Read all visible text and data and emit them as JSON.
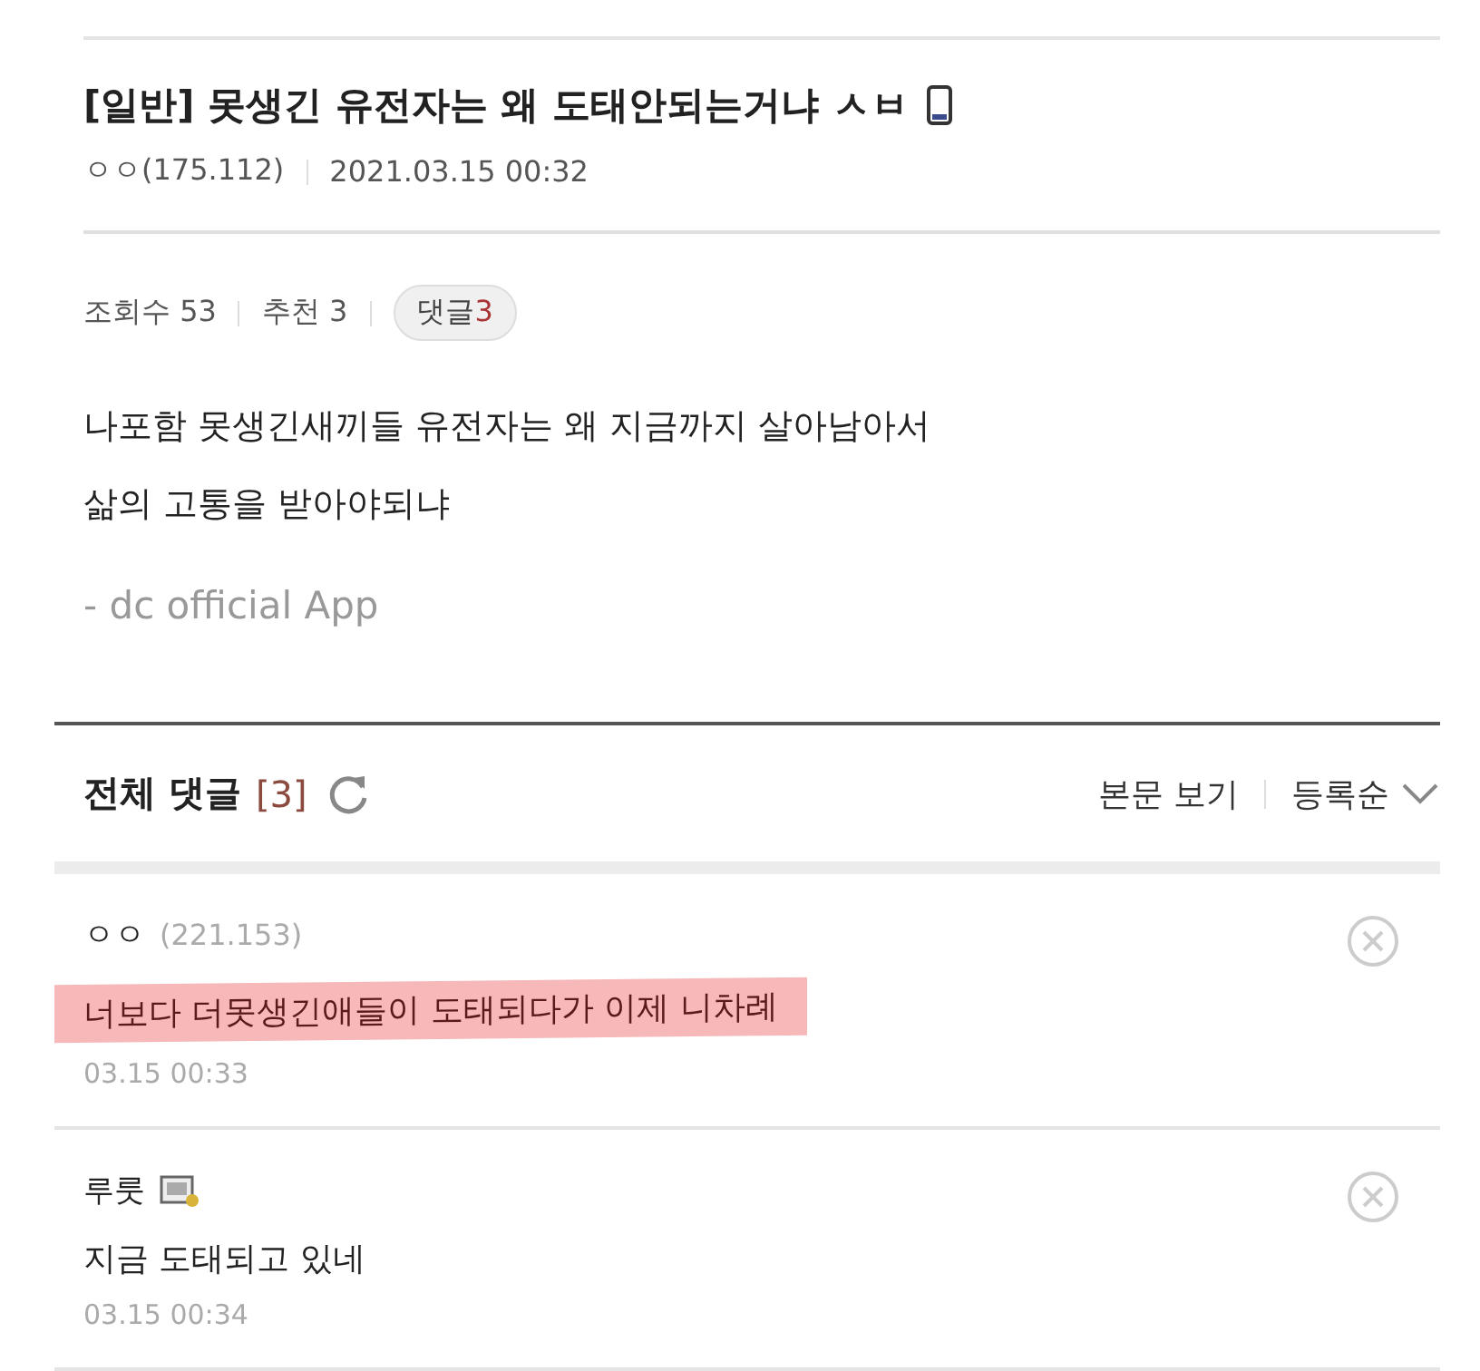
{
  "post": {
    "title": "[일반] 못생긴 유전자는 왜 도태안되는거냐 ㅅㅂ",
    "mobile": true,
    "author": "ㅇㅇ(175.112)",
    "date": "2021.03.15 00:32",
    "views": "조회수 53",
    "recommend": "추천 3",
    "comment_label": "댓글",
    "comment_count": "3",
    "body": [
      "나포함 못생긴새끼들 유전자는 왜 지금까지 살아남아서",
      "삶의 고통을 받아야되냐"
    ],
    "signature": "- dc official App"
  },
  "comments_header": {
    "title": "전체 댓글",
    "count": "[3]",
    "view_post": "본문 보기",
    "sort": "등록순"
  },
  "comments": [
    {
      "name": "ㅇㅇ",
      "ip": "(221.153)",
      "text": "너보다 더못생긴애들이 도태되다가 이제 니차례",
      "date": "03.15 00:33",
      "highlighted": true
    },
    {
      "name": "루룻",
      "member": true,
      "text": "지금 도태되고 있네",
      "date": "03.15 00:34",
      "highlighted": false
    }
  ]
}
